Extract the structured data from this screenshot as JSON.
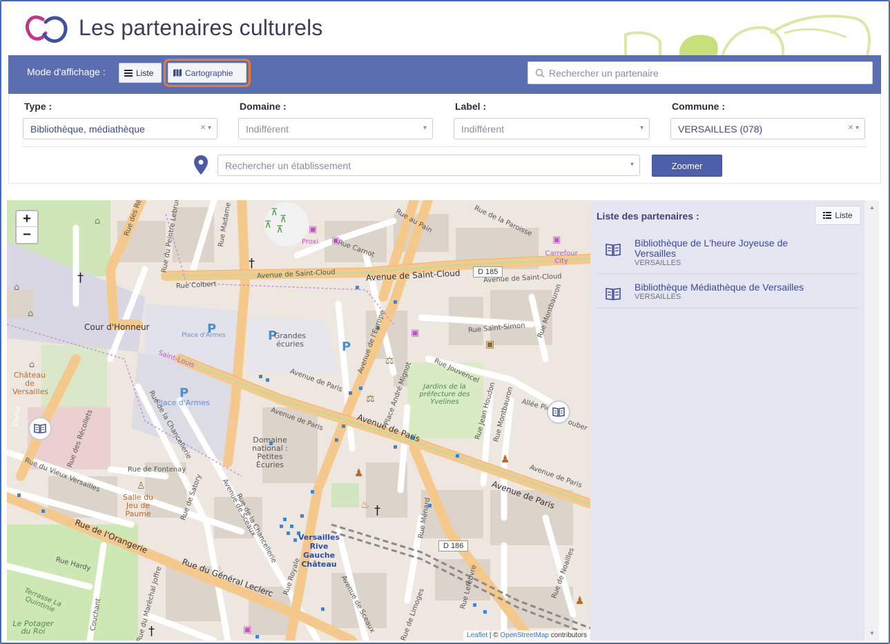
{
  "header": {
    "title": "Les partenaires culturels"
  },
  "modebar": {
    "label": "Mode d'affichage :",
    "liste_label": "Liste",
    "carto_label": "Cartographie",
    "search_placeholder": "Rechercher un partenaire"
  },
  "filters": {
    "type": {
      "label": "Type :",
      "value": "Bibliothèque, médiathèque"
    },
    "domaine": {
      "label": "Domaine :",
      "value": "Indifférent"
    },
    "label": {
      "label": "Label :",
      "value": "Indifférent"
    },
    "commune": {
      "label": "Commune :",
      "value": "VERSAILLES (078)"
    },
    "etablissement_placeholder": "Rechercher un établissement",
    "zoom_label": "Zoomer"
  },
  "map": {
    "zoom_in": "+",
    "zoom_out": "−",
    "labels": {
      "rue_des_reservoirs": "Rue des Ré",
      "rue_pentre": "Rue du Peintre Lebrun",
      "rue_madame": "Rue Madame",
      "proxi": "Proxi",
      "rue_carnot": "Rue Carnot",
      "rue_au_pain": "Rue au Pain",
      "rue_paroisse": "Rue de la Paroisse",
      "carrefour": "Carrefour City",
      "rue_colbert": "Rue Colbert",
      "av_saint_cloud_1": "Avenue de Saint-Cloud",
      "av_saint_cloud_2": "Avenue de Saint-Cloud",
      "av_saint_cloud_3": "Avenue de Saint-Cloud",
      "d185": "D 185",
      "cour_honneur": "Cour d'Honneur",
      "place_armes_1": "Place d'Armes",
      "grandes_ecuries": "Grandes écuries",
      "saint_louis": "Saint-Louis",
      "rue_saint_simon": "Rue Saint-Simon",
      "rue_montbauron": "Rue Montbauron",
      "chateau": "Château de Versailles",
      "av_europe": "Avenue de l'Europe",
      "rue_jouvencel": "Rue Jouvencel",
      "jardins": "Jardins de la préfecture des Yvelines",
      "place_armes_2": "Place d'Armes",
      "av_paris_1": "Avenue de Paris",
      "av_paris_2": "Avenue de Paris",
      "av_paris_3": "Avenue de Paris",
      "av_paris_4": "Avenue de Paris",
      "av_paris_5": "Avenue de Paris",
      "allee_pierre": "Allée Pie",
      "rue_chancellerie": "Rue de la Chancellerie",
      "domaine_national": "Domaine national : Petites Écuries",
      "rue_fontenay": "Rue de Fontenay",
      "rue_vieux_versailles": "Rue du Vieux Versailles",
      "salle_jeu_paume": "Salle du Jeu de Paume",
      "rue_satory": "Rue de Satory",
      "av_sceaux": "Avenue de Sceaux",
      "rue_orangerie": "Rue de l'Orangerie",
      "rue_hardy": "Rue Hardy",
      "station": "Versailles Rive Gauche Château",
      "d186": "D 186",
      "rue_general_leclerc": "Rue du Général Leclerc",
      "rue_royale": "Rue Royale",
      "terrasse": "Terrasse La Quintinie",
      "potager": "Le Potager du Roi",
      "rue_marechal_joffre": "Rue du Maréchal Joffre",
      "rue_menard": "Rue Ménard",
      "rue_limoges": "Rue de Limoges",
      "rue_noailles": "Rue de Noailles",
      "rue_recollets": "Rue des Récollets",
      "rue_andre_mignot": "Place André Mignot",
      "rue_jean_houdon": "Rue Jean Houdon",
      "rue_lefebvre": "Rue Lefebvre",
      "couchant": "Couchant",
      "dame": "Dame",
      "rue_joubert": "ouber"
    },
    "attribution_leaflet": "Leaflet",
    "attribution_sep": " | © ",
    "attribution_osm": "OpenStreetMap",
    "attribution_tail": " contributors"
  },
  "side": {
    "title": "Liste des partenaires :",
    "liste_button": "Liste",
    "partners": [
      {
        "name": "Bibliothèque de L'heure Joyeuse de Versailles",
        "city": "VERSAILLES"
      },
      {
        "name": "Bibliothèque Médiathèque de Versailles",
        "city": "VERSAILLES"
      }
    ]
  },
  "colors": {
    "brand_blue": "#5b6fb0",
    "zoom_button": "#4c5fa8",
    "highlight_orange": "#ee7a2b",
    "panel_bg": "#e4e6f1",
    "partner_text": "#3d4a94"
  }
}
